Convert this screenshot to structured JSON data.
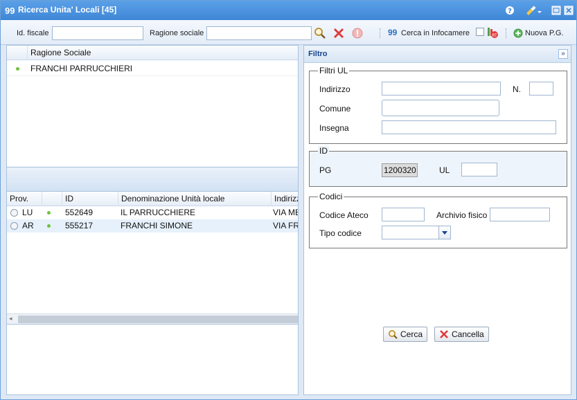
{
  "window": {
    "title": "Ricerca Unita' Locali [45]",
    "title_glyph": "99"
  },
  "toolbar": {
    "id_fiscale_label": "Id. fiscale",
    "id_fiscale_value": "",
    "ragione_sociale_label": "Ragione sociale",
    "ragione_sociale_value": "",
    "infocamere_glyph": "99",
    "infocamere_label": "Cerca in Infocamere",
    "nuova_pg_label": "Nuova P.G."
  },
  "grid_top": {
    "header": "Ragione Sociale",
    "rows": [
      {
        "ragione_sociale": "FRANCHI PARRUCCHIERI"
      }
    ]
  },
  "grid_bottom": {
    "columns": [
      "Prov.",
      "",
      "ID",
      "Denominazione Unità locale",
      "Indirizz"
    ],
    "rows": [
      {
        "prov": "LU",
        "id": "552649",
        "denominazione": "IL PARRUCCHIERE",
        "indirizzo": "VIA ME"
      },
      {
        "prov": "AR",
        "id": "555217",
        "denominazione": "FRANCHI SIMONE",
        "indirizzo": "VIA FR"
      }
    ]
  },
  "filter": {
    "title": "Filtro",
    "filtri_ul": {
      "legend": "Filtri UL",
      "indirizzo_label": "Indirizzo",
      "numero_label": "N.",
      "comune_label": "Comune",
      "insegna_label": "Insegna"
    },
    "id_section": {
      "legend": "ID",
      "pg_label": "PG",
      "pg_value": "1200320",
      "ul_label": "UL",
      "ul_value": ""
    },
    "codici": {
      "legend": "Codici",
      "ateco_label": "Codice Ateco",
      "archivio_label": "Archivio fisico",
      "tipo_label": "Tipo codice",
      "tipo_value": ""
    },
    "cerca_label": "Cerca",
    "cancella_label": "Cancella"
  },
  "colors": {
    "titlebar": "#3f86d6",
    "accent": "#15428b",
    "status_green": "#6fc23b",
    "delete_red": "#e03b3b"
  }
}
